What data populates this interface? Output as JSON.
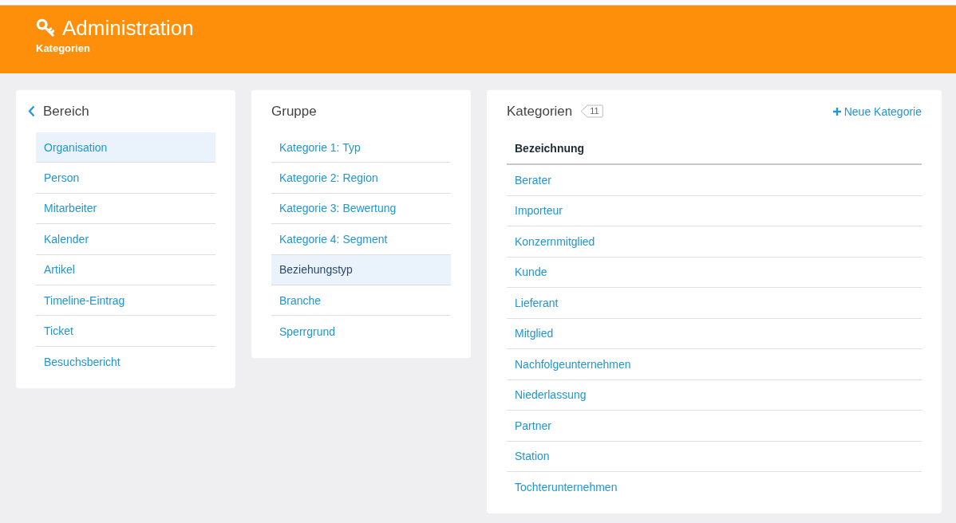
{
  "header": {
    "title": "Administration",
    "subtitle": "Kategorien"
  },
  "areas": {
    "title": "Bereich",
    "items": [
      {
        "label": "Organisation",
        "selected": true,
        "current": false
      },
      {
        "label": "Person",
        "selected": false,
        "current": false
      },
      {
        "label": "Mitarbeiter",
        "selected": false,
        "current": false
      },
      {
        "label": "Kalender",
        "selected": false,
        "current": false
      },
      {
        "label": "Artikel",
        "selected": false,
        "current": false
      },
      {
        "label": "Timeline-Eintrag",
        "selected": false,
        "current": false
      },
      {
        "label": "Ticket",
        "selected": false,
        "current": false
      },
      {
        "label": "Besuchsbericht",
        "selected": false,
        "current": false
      }
    ]
  },
  "groups": {
    "title": "Gruppe",
    "items": [
      {
        "label": "Kategorie 1: Typ",
        "selected": false,
        "current": false
      },
      {
        "label": "Kategorie 2: Region",
        "selected": false,
        "current": false
      },
      {
        "label": "Kategorie 3: Bewertung",
        "selected": false,
        "current": false
      },
      {
        "label": "Kategorie 4: Segment",
        "selected": false,
        "current": false
      },
      {
        "label": "Beziehungstyp",
        "selected": true,
        "current": true
      },
      {
        "label": "Branche",
        "selected": false,
        "current": false
      },
      {
        "label": "Sperrgrund",
        "selected": false,
        "current": false
      }
    ]
  },
  "categories": {
    "title": "Kategorien",
    "count": "11",
    "action": "Neue Kategorie",
    "table": {
      "columns": [
        "Bezeichnung"
      ],
      "rows": [
        [
          "Berater"
        ],
        [
          "Importeur"
        ],
        [
          "Konzernmitglied"
        ],
        [
          "Kunde"
        ],
        [
          "Lieferant"
        ],
        [
          "Mitglied"
        ],
        [
          "Nachfolgeunternehmen"
        ],
        [
          "Niederlassung"
        ],
        [
          "Partner"
        ],
        [
          "Station"
        ],
        [
          "Tochterunternehmen"
        ]
      ]
    }
  }
}
